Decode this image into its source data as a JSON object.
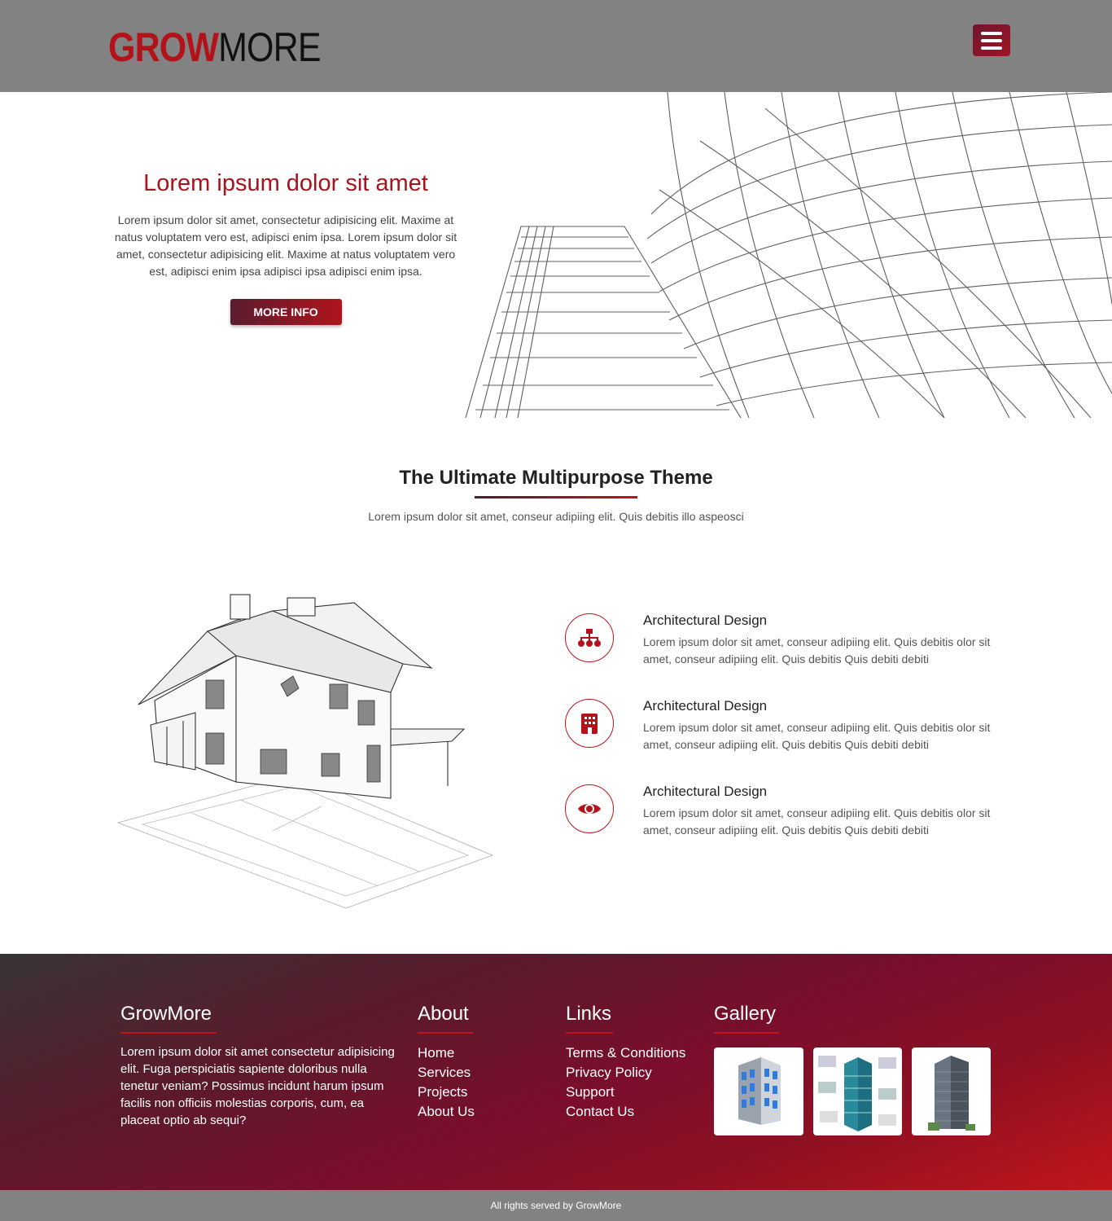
{
  "header": {
    "logo_part1": "GROW",
    "logo_part2": "MORE",
    "menu_icon": "hamburger-menu-icon"
  },
  "hero": {
    "title": "Lorem ipsum dolor sit amet",
    "body": "Lorem ipsum dolor sit amet, consectetur adipisicing elit. Maxime at natus voluptatem vero est, adipisci enim ipsa. Lorem ipsum dolor sit amet, consectetur adipisicing elit. Maxime at natus voluptatem vero est, adipisci enim ipsa adipisci ipsa adipisci enim ipsa.",
    "button_label": "MORE INFO"
  },
  "intro": {
    "title": "The Ultimate Multipurpose Theme",
    "subtitle": "Lorem ipsum dolor sit amet, conseur adipiing elit. Quis debitis illo aspeosci"
  },
  "features": [
    {
      "icon": "sitemap-icon",
      "title": "Architectural Design",
      "body": "Lorem ipsum dolor sit amet, conseur adipiing elit. Quis debitis olor sit amet, conseur adipiing elit. Quis debitis Quis debiti debiti"
    },
    {
      "icon": "building-icon",
      "title": "Architectural Design",
      "body": "Lorem ipsum dolor sit amet, conseur adipiing elit. Quis debitis olor sit amet, conseur adipiing elit. Quis debitis Quis debiti debiti"
    },
    {
      "icon": "eye-icon",
      "title": "Architectural Design",
      "body": "Lorem ipsum dolor sit amet, conseur adipiing elit. Quis debitis olor sit amet, conseur adipiing elit. Quis debitis Quis debiti debiti"
    }
  ],
  "footer": {
    "brand": {
      "title": "GrowMore",
      "text": "Lorem ipsum dolor sit amet consectetur adipisicing elit. Fuga perspiciatis sapiente doloribus nulla tenetur veniam? Possimus incidunt harum ipsum facilis non officiis molestias corporis, cum, ea placeat optio ab sequi?"
    },
    "about": {
      "title": "About",
      "links": [
        "Home",
        "Services",
        "Projects",
        "About Us"
      ]
    },
    "links": {
      "title": "Links",
      "links": [
        "Terms & Conditions",
        "Privacy Policy",
        "Support",
        "Contact Us"
      ]
    },
    "gallery": {
      "title": "Gallery"
    },
    "copyright": "All rights served by GrowMore"
  },
  "colors": {
    "accent": "#b3121a",
    "header_bg": "#828282"
  }
}
